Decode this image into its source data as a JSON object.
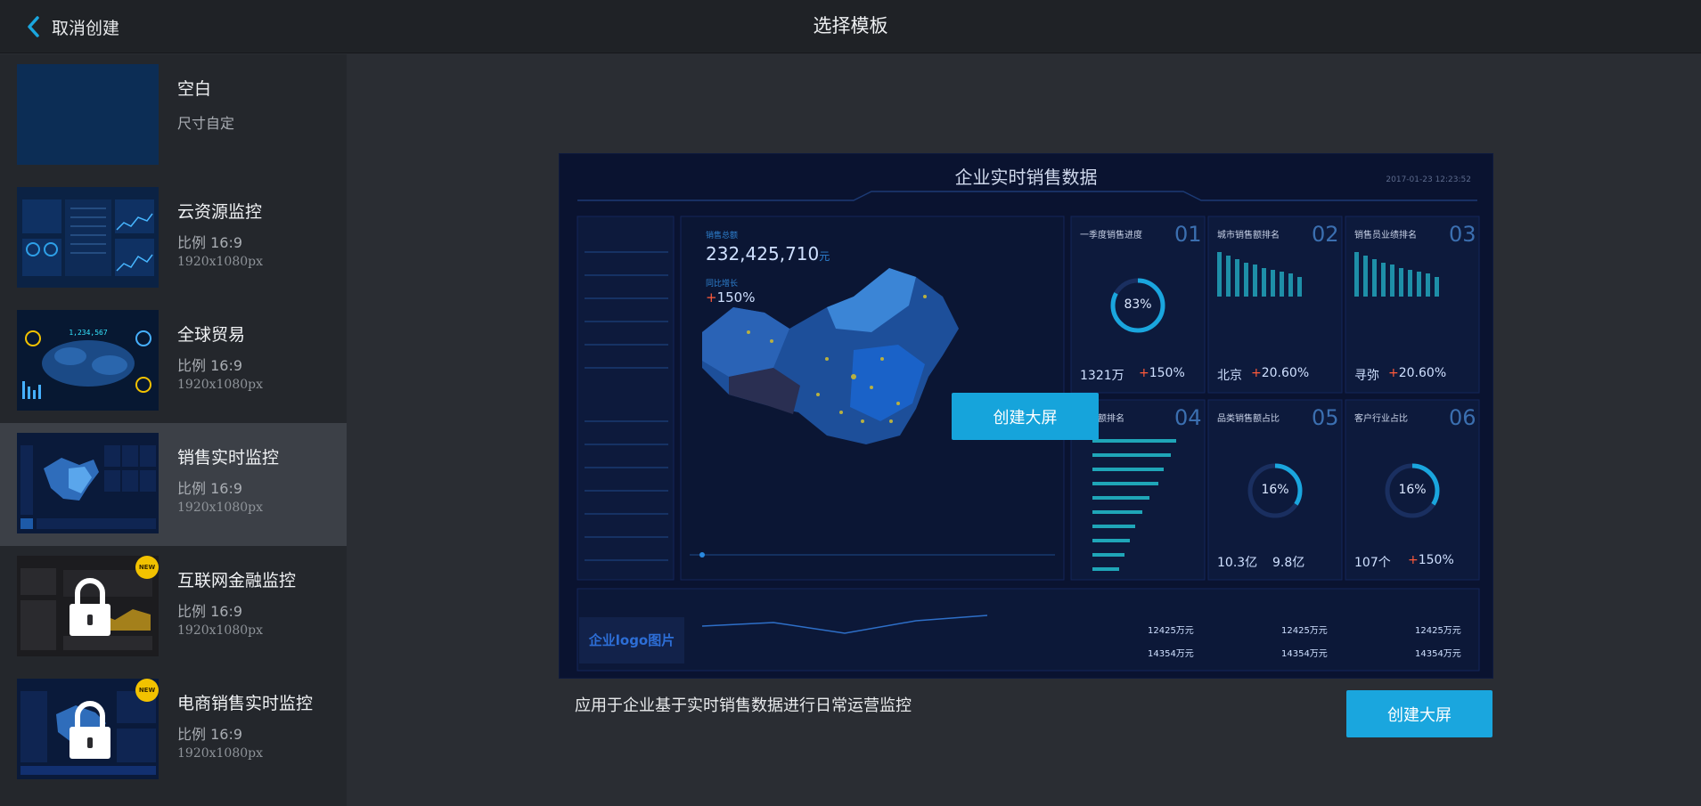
{
  "header": {
    "back_label": "取消创建",
    "title": "选择模板"
  },
  "sidebar": {
    "templates": [
      {
        "name": "空白",
        "subtitle": "尺寸自定"
      },
      {
        "name": "云资源监控",
        "ratio": "比例  16:9",
        "size": "1920x1080px"
      },
      {
        "name": "全球贸易",
        "ratio": "比例  16:9",
        "size": "1920x1080px"
      },
      {
        "name": "销售实时监控",
        "ratio": "比例  16:9",
        "size": "1920x1080px",
        "selected": true
      },
      {
        "name": "互联网金融监控",
        "ratio": "比例  16:9",
        "size": "1920x1080px",
        "badge": "NEW",
        "locked": true
      },
      {
        "name": "电商销售实时监控",
        "ratio": "比例  16:9",
        "size": "1920x1080px",
        "badge": "NEW",
        "locked": true
      }
    ]
  },
  "main": {
    "description": "应用于企业基于实时销售数据进行日常运营监控",
    "create_button": "创建大屏",
    "overlay_button": "创建大屏"
  },
  "preview": {
    "title": "企业实时销售数据",
    "timestamp": "2017-01-23 12:23:52",
    "total_label": "销售总额",
    "total_value": "232,425,710",
    "total_unit": "元",
    "growth_label": "同比增长",
    "growth_value": "150%",
    "cards": [
      {
        "num": "01",
        "title": "一季度销售进度",
        "ring": "83%",
        "stat_a": "1321万",
        "stat_b": "150%"
      },
      {
        "num": "02",
        "title": "城市销售额排名",
        "stat_a": "北京",
        "stat_b": "20.60%"
      },
      {
        "num": "03",
        "title": "销售员业绩排名",
        "stat_a": "寻弥",
        "stat_b": "20.60%"
      },
      {
        "num": "04",
        "title": "销售额排名"
      },
      {
        "num": "05",
        "title": "品类销售额占比",
        "ring": "16%",
        "stat_a": "10.3亿",
        "stat_b": "9.8亿"
      },
      {
        "num": "06",
        "title": "客户行业占比",
        "ring": "16%",
        "stat_a": "107个",
        "stat_b": "150%"
      }
    ],
    "logo_text": "企业logo图片",
    "footer_values": [
      "12425万元",
      "14354万元",
      "12425万元",
      "14354万元",
      "12425万元",
      "14354万元"
    ]
  },
  "colors": {
    "accent": "#1aa6de",
    "badge": "#f2c200",
    "topbar": "#1f2226",
    "sidebar": "#24272c",
    "selected": "#3c4047"
  }
}
